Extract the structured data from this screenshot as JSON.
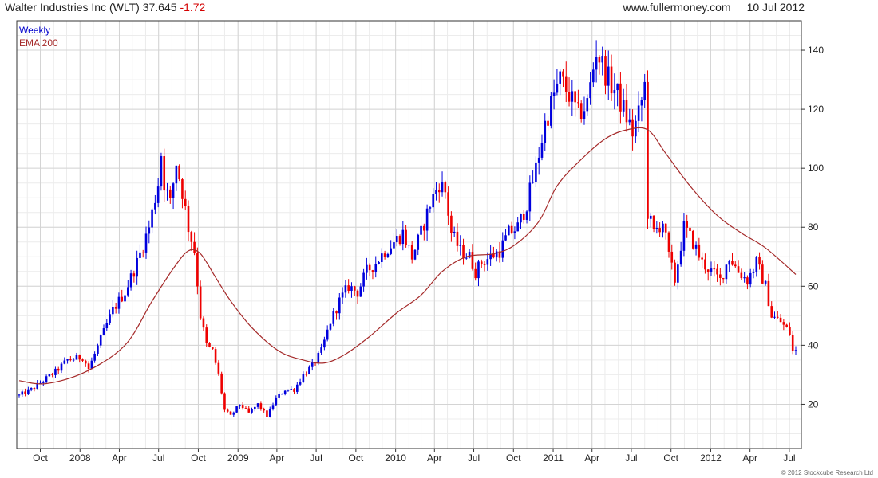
{
  "header": {
    "company": "Walter Industries Inc",
    "ticker": "(WLT)",
    "price": "37.645",
    "change": "-1.72",
    "website": "www.fullermoney.com",
    "date": "10 Jul 2012"
  },
  "legend": {
    "period": "Weekly",
    "ema": "EMA 200"
  },
  "copyright": "© 2012 Stockcube Research Ltd",
  "colors": {
    "up": "#0000dd",
    "down": "#ee0000",
    "ema": "#a52a2a",
    "grid": "#d4d4d4"
  },
  "chart_data": {
    "type": "candlestick",
    "series_name": "Walter Industries Inc (WLT)",
    "y_ticks": [
      20,
      40,
      60,
      80,
      100,
      120,
      140
    ],
    "ylim": [
      5,
      150
    ],
    "x_ticks": [
      "Oct",
      "2008",
      "Apr",
      "Jul",
      "Oct",
      "2009",
      "Apr",
      "Jul",
      "Oct",
      "2010",
      "Apr",
      "Jul",
      "Oct",
      "2011",
      "Apr",
      "Jul",
      "Oct",
      "2012",
      "Apr",
      "Jul"
    ],
    "x_tick_dates": [
      "2007-10-01",
      "2008-01-01",
      "2008-04-01",
      "2008-07-01",
      "2008-10-01",
      "2009-01-01",
      "2009-04-01",
      "2009-07-01",
      "2009-10-01",
      "2010-01-01",
      "2010-04-01",
      "2010-07-01",
      "2010-10-01",
      "2011-01-01",
      "2011-04-01",
      "2011-07-01",
      "2011-10-01",
      "2012-01-01",
      "2012-04-01",
      "2012-07-01"
    ],
    "x_range": [
      "2007-08-13",
      "2012-07-16"
    ],
    "close_anchors": [
      [
        "2007-08-13",
        23
      ],
      [
        "2007-09-10",
        25
      ],
      [
        "2007-10-08",
        28
      ],
      [
        "2007-11-05",
        31
      ],
      [
        "2007-12-03",
        35
      ],
      [
        "2008-01-07",
        36
      ],
      [
        "2008-01-21",
        32
      ],
      [
        "2008-02-18",
        42
      ],
      [
        "2008-03-17",
        52
      ],
      [
        "2008-04-14",
        58
      ],
      [
        "2008-05-12",
        68
      ],
      [
        "2008-06-09",
        80
      ],
      [
        "2008-06-30",
        95
      ],
      [
        "2008-07-07",
        105
      ],
      [
        "2008-07-14",
        95
      ],
      [
        "2008-07-28",
        88
      ],
      [
        "2008-08-11",
        102
      ],
      [
        "2008-08-25",
        92
      ],
      [
        "2008-09-08",
        80
      ],
      [
        "2008-09-22",
        72
      ],
      [
        "2008-10-06",
        50
      ],
      [
        "2008-10-20",
        40
      ],
      [
        "2008-11-03",
        38
      ],
      [
        "2008-11-17",
        30
      ],
      [
        "2008-12-01",
        18
      ],
      [
        "2008-12-15",
        16
      ],
      [
        "2009-01-05",
        20
      ],
      [
        "2009-01-26",
        17
      ],
      [
        "2009-02-16",
        20
      ],
      [
        "2009-03-09",
        16
      ],
      [
        "2009-03-30",
        22
      ],
      [
        "2009-04-20",
        25
      ],
      [
        "2009-05-11",
        25
      ],
      [
        "2009-06-01",
        30
      ],
      [
        "2009-06-22",
        33
      ],
      [
        "2009-07-13",
        38
      ],
      [
        "2009-08-03",
        48
      ],
      [
        "2009-08-24",
        55
      ],
      [
        "2009-09-14",
        60
      ],
      [
        "2009-10-05",
        58
      ],
      [
        "2009-10-26",
        65
      ],
      [
        "2009-11-16",
        68
      ],
      [
        "2009-12-07",
        72
      ],
      [
        "2009-12-28",
        75
      ],
      [
        "2010-01-18",
        78
      ],
      [
        "2010-02-08",
        70
      ],
      [
        "2010-03-01",
        78
      ],
      [
        "2010-03-22",
        88
      ],
      [
        "2010-04-12",
        95
      ],
      [
        "2010-04-26",
        92
      ],
      [
        "2010-05-10",
        78
      ],
      [
        "2010-05-31",
        72
      ],
      [
        "2010-06-21",
        70
      ],
      [
        "2010-07-05",
        65
      ],
      [
        "2010-07-19",
        68
      ],
      [
        "2010-08-09",
        70
      ],
      [
        "2010-08-30",
        72
      ],
      [
        "2010-09-20",
        78
      ],
      [
        "2010-10-11",
        80
      ],
      [
        "2010-11-01",
        88
      ],
      [
        "2010-11-22",
        100
      ],
      [
        "2010-12-13",
        115
      ],
      [
        "2011-01-03",
        125
      ],
      [
        "2011-01-17",
        130
      ],
      [
        "2011-02-07",
        125
      ],
      [
        "2011-02-28",
        118
      ],
      [
        "2011-03-21",
        122
      ],
      [
        "2011-04-11",
        140
      ],
      [
        "2011-04-25",
        135
      ],
      [
        "2011-05-09",
        130
      ],
      [
        "2011-05-30",
        125
      ],
      [
        "2011-06-13",
        120
      ],
      [
        "2011-07-04",
        112
      ],
      [
        "2011-07-18",
        118
      ],
      [
        "2011-08-01",
        128
      ],
      [
        "2011-08-08",
        85
      ],
      [
        "2011-08-22",
        78
      ],
      [
        "2011-09-12",
        82
      ],
      [
        "2011-09-26",
        70
      ],
      [
        "2011-10-10",
        62
      ],
      [
        "2011-10-31",
        80
      ],
      [
        "2011-11-21",
        75
      ],
      [
        "2011-12-12",
        68
      ],
      [
        "2012-01-02",
        65
      ],
      [
        "2012-01-23",
        62
      ],
      [
        "2012-02-13",
        70
      ],
      [
        "2012-03-05",
        65
      ],
      [
        "2012-03-26",
        62
      ],
      [
        "2012-04-16",
        68
      ],
      [
        "2012-05-07",
        60
      ],
      [
        "2012-05-21",
        50
      ],
      [
        "2012-06-11",
        48
      ],
      [
        "2012-07-02",
        44
      ],
      [
        "2012-07-09",
        38
      ]
    ],
    "ema_anchors": [
      [
        "2007-08-13",
        28
      ],
      [
        "2007-10-15",
        27
      ],
      [
        "2008-01-14",
        31
      ],
      [
        "2008-04-14",
        40
      ],
      [
        "2008-06-16",
        55
      ],
      [
        "2008-08-04",
        66
      ],
      [
        "2008-09-08",
        72
      ],
      [
        "2008-10-06",
        71
      ],
      [
        "2008-11-10",
        63
      ],
      [
        "2008-12-15",
        55
      ],
      [
        "2009-02-02",
        46
      ],
      [
        "2009-04-06",
        38
      ],
      [
        "2009-06-01",
        35
      ],
      [
        "2009-07-20",
        34
      ],
      [
        "2009-09-07",
        37
      ],
      [
        "2009-11-02",
        43
      ],
      [
        "2010-01-04",
        51
      ],
      [
        "2010-03-01",
        57
      ],
      [
        "2010-04-19",
        65
      ],
      [
        "2010-06-14",
        70
      ],
      [
        "2010-08-16",
        71
      ],
      [
        "2010-10-04",
        74
      ],
      [
        "2010-11-29",
        82
      ],
      [
        "2011-01-10",
        94
      ],
      [
        "2011-03-07",
        103
      ],
      [
        "2011-05-02",
        110
      ],
      [
        "2011-06-20",
        113
      ],
      [
        "2011-08-08",
        113
      ],
      [
        "2011-09-19",
        105
      ],
      [
        "2011-11-14",
        94
      ],
      [
        "2012-01-16",
        84
      ],
      [
        "2012-03-12",
        78
      ],
      [
        "2012-05-07",
        73
      ],
      [
        "2012-07-16",
        64
      ]
    ]
  }
}
